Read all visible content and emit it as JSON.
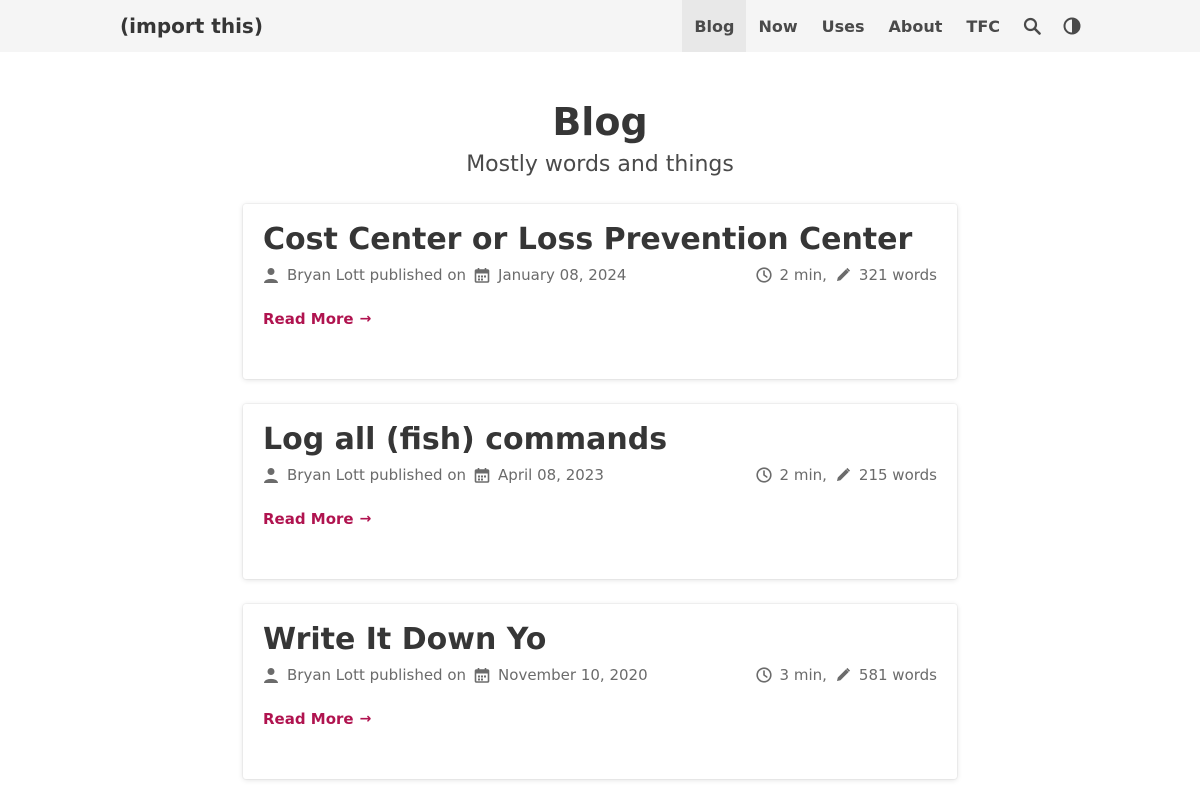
{
  "navbar": {
    "brand": "(import this)",
    "items": [
      {
        "label": "Blog",
        "active": true
      },
      {
        "label": "Now",
        "active": false
      },
      {
        "label": "Uses",
        "active": false
      },
      {
        "label": "About",
        "active": false
      },
      {
        "label": "TFC",
        "active": false
      }
    ],
    "icons": [
      "search-icon",
      "theme-toggle-icon"
    ]
  },
  "header": {
    "title": "Blog",
    "subtitle": "Mostly words and things"
  },
  "posts": [
    {
      "title": "Cost Center or Loss Prevention Center",
      "author": "Bryan Lott",
      "published_label": "published on",
      "date": "January 08, 2024",
      "read_time": "2 min,",
      "word_count": "321 words",
      "read_more": "Read More"
    },
    {
      "title": "Log all (fish) commands",
      "author": "Bryan Lott",
      "published_label": "published on",
      "date": "April 08, 2023",
      "read_time": "2 min,",
      "word_count": "215 words",
      "read_more": "Read More"
    },
    {
      "title": "Write It Down Yo",
      "author": "Bryan Lott",
      "published_label": "published on",
      "date": "November 10, 2020",
      "read_time": "3 min,",
      "word_count": "581 words",
      "read_more": "Read More"
    }
  ],
  "colors": {
    "navbar_bg": "#f5f5f5",
    "active_nav_bg": "#e8e8e8",
    "link_accent": "#b0134f",
    "title_text": "#363636",
    "meta_text": "#6b6b6b"
  }
}
